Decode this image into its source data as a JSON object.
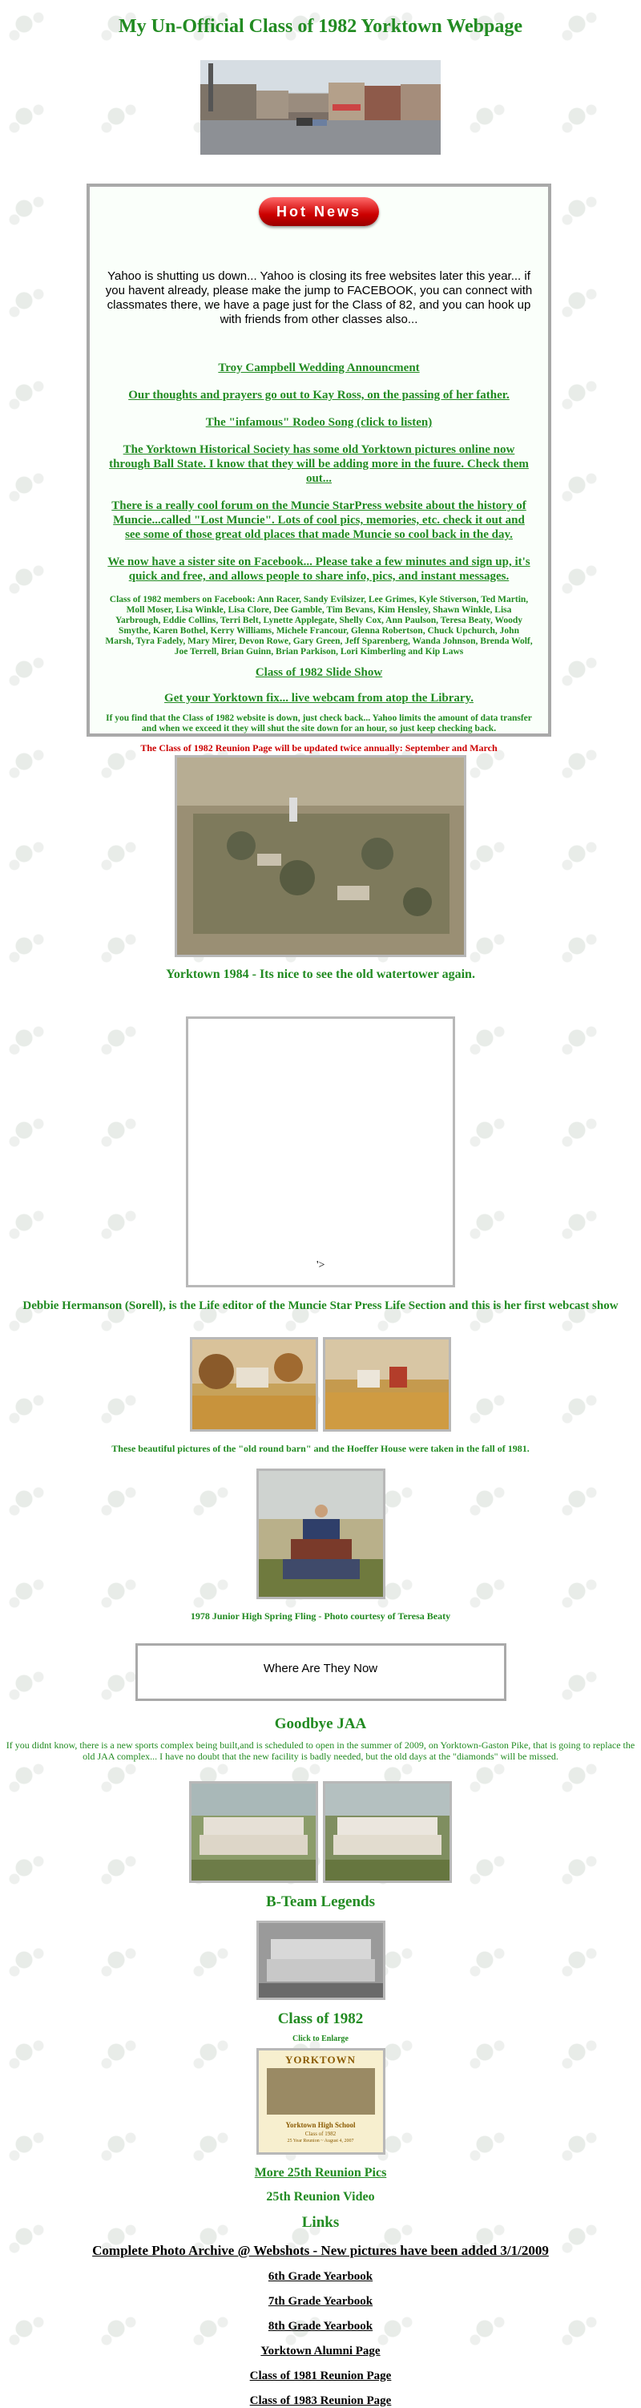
{
  "page": {
    "title": "My Un-Official Class of 1982 Yorktown Webpage"
  },
  "news": {
    "badge": "Hot News",
    "intro": "Yahoo is shutting us down... Yahoo is closing its free websites later this year... if you havent already, please make the jump to FACEBOOK, you can connect with classmates there, we have a page just for the Class of 82, and you can hook up with friends from other classes also...",
    "items": [
      "Troy Campbell Wedding Announcment",
      "Our thoughts and prayers go out to Kay Ross, on the passing of her father.",
      "The \"infamous\" Rodeo Song (click to listen)",
      "The Yorktown Historical Society has some old Yorktown pictures online now through Ball State. I know that they will be adding more in the fuure. Check them out...",
      "There is a really cool forum on the Muncie StarPress website about the history of Muncie...called \"Lost Muncie\". Lots of cool pics, memories, etc. check it out and see some of those great old places that made Muncie so cool back in the day.",
      "We now have a sister site on Facebook... Please take a few minutes and sign up, it's quick and free, and allows people to share info, pics, and instant messages."
    ],
    "facebook_members": "Class of 1982 members on Facebook: Ann Racer, Sandy Evilsizer, Lee Grimes, Kyle Stiverson, Ted Martin, Moll Moser, Lisa Winkle, Lisa Clore, Dee Gamble, Tim Bevans, Kim Hensley, Shawn Winkle, Lisa Yarbrough, Eddie Collins, Terri Belt, Lynette Applegate, Shelly Cox, Ann Paulson, Teresa Beaty, Woody Smythe, Karen Bothel, Kerry Williams, Michele Francour, Glenna Robertson, Chuck Upchurch, John Marsh, Tyra Fadely, Mary Mirer, Devon Rowe, Gary Green, Jeff Sparenberg, Wanda Johnson, Brenda Wolf, Joe Terrell, Brian Guinn, Brian Parkison, Lori Kimberling and Kip Laws",
    "slide_show": "Class of 1982 Slide Show",
    "webcam": "Get your Yorktown fix... live webcam from atop the Library.",
    "site_down_note": "If you find that the Class of 1982 website is down, just check back... Yahoo limits the amount of data transfer and when we exceed it they will shut the site down for an hour, so just keep checking back.",
    "reunion_note": "The Class of 1982 Reunion Page will be updated twice annually: September and March"
  },
  "aerial": {
    "caption": "Yorktown 1984 - Its nice to see the old watertower again."
  },
  "webcast": {
    "stray_text": "'>",
    "caption": "Debbie Hermanson (Sorell), is the Life editor of the Muncie Star Press Life Section and this is her first webcast show"
  },
  "barn": {
    "caption": "These beautiful pictures of the \"old round barn\" and the Hoeffer House were taken in the fall of 1981."
  },
  "spring_fling": {
    "caption": "1978 Junior High Spring Fling - Photo courtesy of Teresa Beaty"
  },
  "where_box": {
    "label": "Where Are They Now"
  },
  "jaa": {
    "heading": "Goodbye JAA",
    "text": "If you didnt know, there is a new sports complex being built,and is scheduled to open in the summer of 2009, on Yorktown-Gaston Pike, that is going to replace the old JAA complex... I have no doubt that the new facility is badly needed, but the old days at the \"diamonds\" will be missed."
  },
  "bteam": {
    "heading": "B-Team Legends"
  },
  "class_photo": {
    "heading": "Class of 1982",
    "enlarge": "Click to Enlarge",
    "photo_title": "YORKTOWN",
    "photo_school": "Yorktown High School",
    "photo_class": "Class of 1982",
    "photo_reunion": "25 Year Reunion ~ August 4, 2007"
  },
  "reunion_links": {
    "more_pics": "More 25th Reunion Pics",
    "video": "25th Reunion Video"
  },
  "links": {
    "heading": "Links",
    "items": [
      "Complete Photo Archive @ Webshots - New pictures have been added 3/1/2009",
      "6th Grade Yearbook",
      "7th Grade Yearbook",
      "8th Grade Yearbook",
      "Yorktown Alumni Page",
      "Class of 1981 Reunion Page",
      "Class of 1983 Reunion Page"
    ]
  },
  "colors": {
    "green": "#228B22",
    "red": "#cc0000",
    "frame": "#b8b8b8"
  }
}
